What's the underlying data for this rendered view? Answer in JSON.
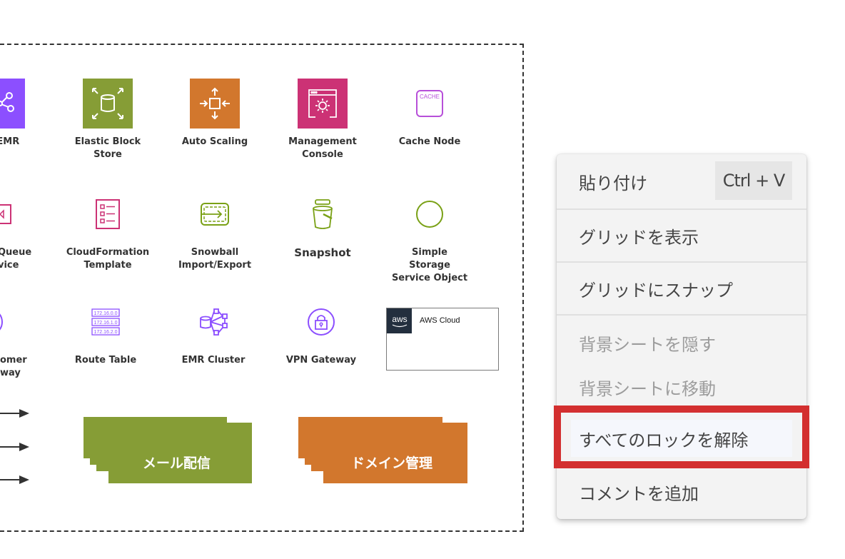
{
  "diagram": {
    "nodes": [
      {
        "label": "on EMR",
        "icon": "emr-icon",
        "color": "#8c4fff"
      },
      {
        "label": "Elastic Block\nStore",
        "icon": "elastic-block-store-icon",
        "color": "#7aa116"
      },
      {
        "label": "Auto Scaling",
        "icon": "auto-scaling-icon",
        "color": "#d4762c"
      },
      {
        "label": "Management\nConsole",
        "icon": "management-console-icon",
        "color": "#cc3275"
      },
      {
        "label": "Cache Node",
        "icon": "cache-node-icon",
        "color": "#b74fd9",
        "icon_text": "CACHE"
      },
      {
        "label": " Queue\nvice",
        "icon": "queue-service-icon",
        "color": "#cc3275"
      },
      {
        "label": "CloudFormation\nTemplate",
        "icon": "cloudformation-template-icon",
        "color": "#cc3275"
      },
      {
        "label": "Snowball\nImport/Export",
        "icon": "snowball-icon",
        "color": "#7aa116"
      },
      {
        "label": "Snapshot",
        "icon": "snapshot-icon",
        "color": "#7aa116"
      },
      {
        "label": "Simple\nStorage\nService Object",
        "icon": "s3-object-icon",
        "color": "#7aa116"
      },
      {
        "label": "omer\nway",
        "icon": "customer-gateway-icon",
        "color": "#8c4fff"
      },
      {
        "label": "Route Table",
        "icon": "route-table-icon",
        "color": "#8c4fff",
        "icon_rows": [
          "172.16.0.0",
          "172.16.1.0",
          "172.16.2.0"
        ]
      },
      {
        "label": "EMR Cluster",
        "icon": "emr-cluster-icon",
        "color": "#8c4fff"
      },
      {
        "label": "VPN Gateway",
        "icon": "vpn-gateway-icon",
        "color": "#8c4fff"
      }
    ],
    "aws_cloud": {
      "badge": "aws",
      "title": "AWS Cloud"
    },
    "stacks": [
      {
        "label": "メール配信",
        "color": "#869d36"
      },
      {
        "label": "ドメイン管理",
        "color": "#d2772d"
      }
    ]
  },
  "context_menu": {
    "items": [
      {
        "label": "貼り付け",
        "shortcut": "Ctrl + V",
        "disabled": false
      },
      {
        "label": "グリッドを表示",
        "disabled": false
      },
      {
        "label": "グリッドにスナップ",
        "disabled": false
      },
      {
        "label": "背景シートを隠す",
        "disabled": true
      },
      {
        "label": "背景シートに移動",
        "disabled": true
      },
      {
        "label": "すべてのロックを解除",
        "disabled": false,
        "highlighted": true
      },
      {
        "label": "コメントを追加",
        "disabled": false
      }
    ],
    "highlight_color": "#d32f2f"
  }
}
